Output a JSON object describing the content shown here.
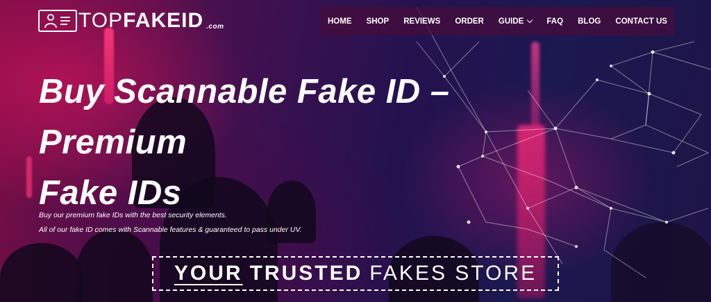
{
  "brand": {
    "name_light": "TOP",
    "name_bold": "FAKEID",
    "suffix": ".com",
    "icon": "id-card-icon"
  },
  "nav": {
    "items": [
      {
        "label": "HOME"
      },
      {
        "label": "SHOP"
      },
      {
        "label": "REVIEWS"
      },
      {
        "label": "ORDER"
      },
      {
        "label": "GUIDE",
        "icon": "chevron-down-icon"
      },
      {
        "label": "FAQ"
      },
      {
        "label": "BLOG"
      },
      {
        "label": "CONTACT US"
      }
    ]
  },
  "hero": {
    "headline_lines": [
      "Buy Scannable Fake ID –",
      "Premium",
      "Fake IDs"
    ],
    "subtext": [
      "Buy our premium fake IDs with the best security elements.",
      "All of our fake ID comes with Scannable features & guaranteed to pass under UV."
    ],
    "badge": {
      "word1": "YOUR",
      "word2": "TRUSTED",
      "word3": "FAKES STORE"
    }
  },
  "colors": {
    "accent_pink": "#e0206a",
    "nav_bg": "#460c3c",
    "text": "#ffffff"
  }
}
